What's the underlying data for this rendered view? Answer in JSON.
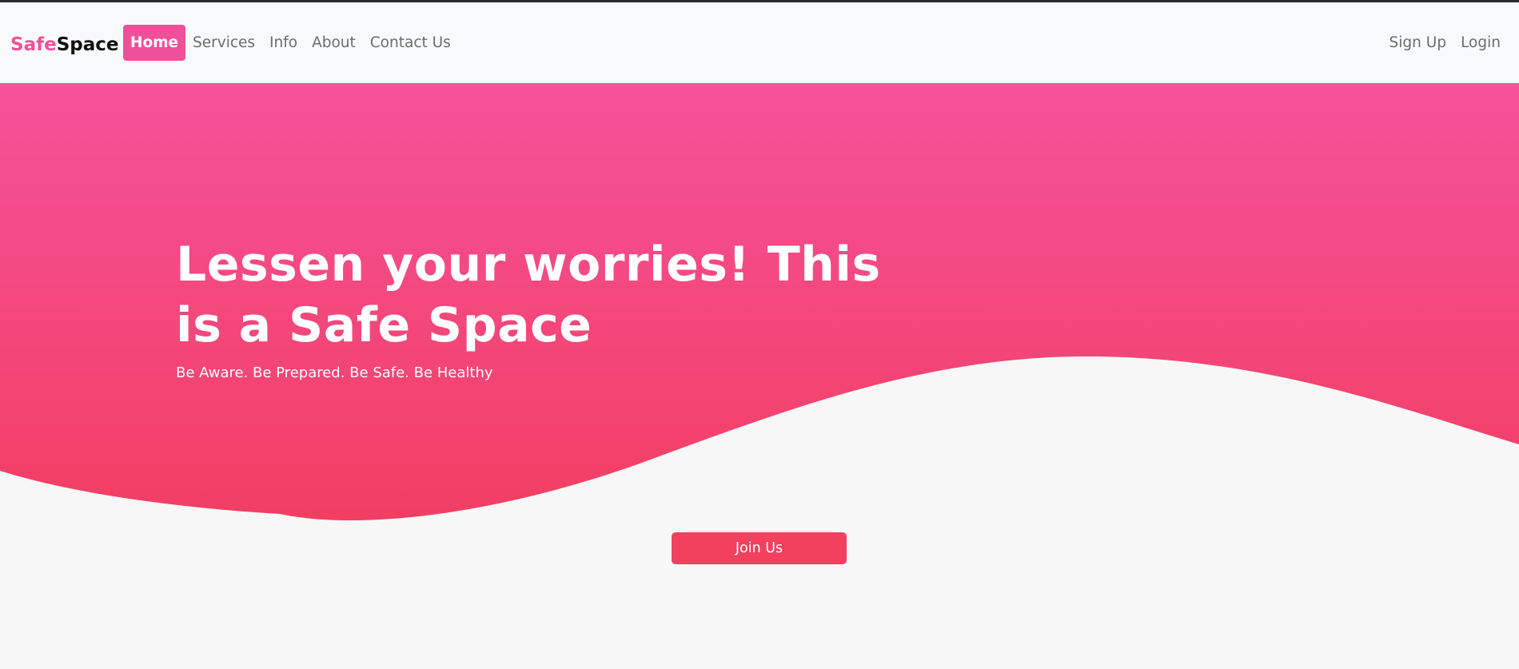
{
  "brand": {
    "part1": "Safe",
    "part2": "Space"
  },
  "nav": {
    "items": [
      {
        "label": "Home",
        "active": true
      },
      {
        "label": "Services",
        "active": false
      },
      {
        "label": "Info",
        "active": false
      },
      {
        "label": "About",
        "active": false
      },
      {
        "label": "Contact Us",
        "active": false
      }
    ],
    "right": {
      "signup": "Sign Up",
      "login": "Login"
    }
  },
  "hero": {
    "title_line1": "Lessen your worries! This",
    "title_line2": "is a Safe Space",
    "subtitle": "Be Aware. Be Prepared. Be Safe. Be Healthy"
  },
  "cta": {
    "join_label": "Join Us"
  },
  "colors": {
    "accent": "#f0509a",
    "hero_top": "#f5529b",
    "hero_bottom": "#f23e62",
    "button": "#f2405f",
    "page_bg": "#f7f7f8"
  }
}
